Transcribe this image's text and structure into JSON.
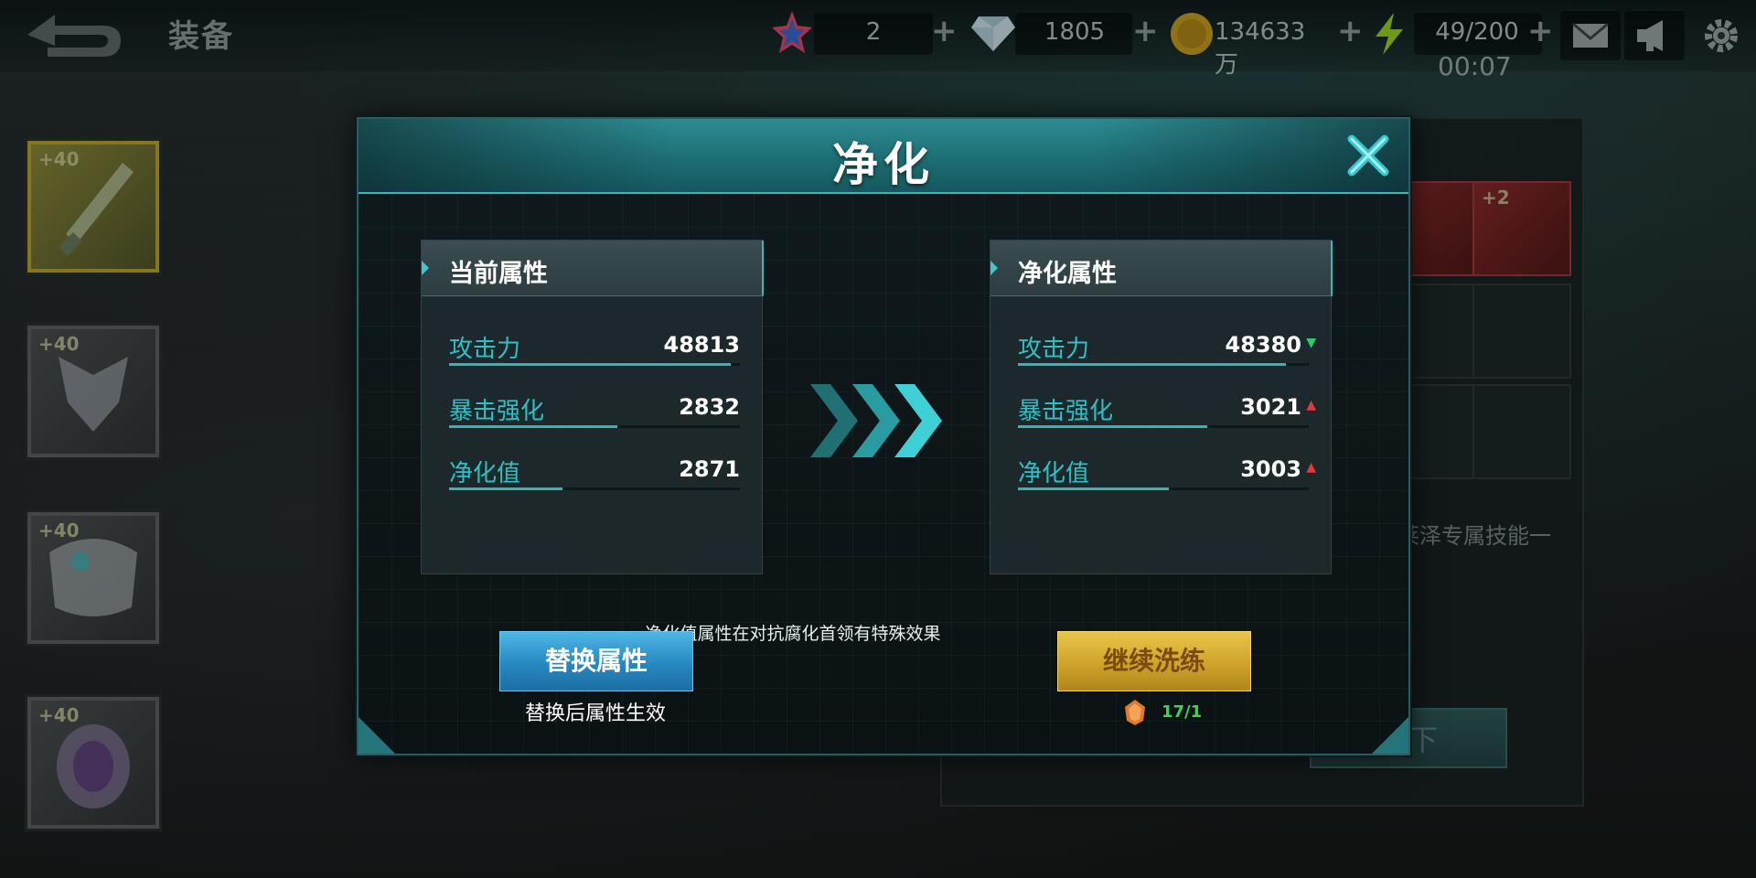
{
  "topbar": {
    "title": "装备",
    "resources": [
      {
        "name": "star-gem",
        "value": "2"
      },
      {
        "name": "diamond",
        "value": "1805"
      },
      {
        "name": "gold-coin",
        "value": "134633万"
      },
      {
        "name": "energy",
        "value": "49/200"
      }
    ],
    "timer": "00:07"
  },
  "modal": {
    "title": "净化",
    "current_panel": {
      "header": "当前属性",
      "rows": [
        {
          "name": "攻击力",
          "value": "48813",
          "fill": 0.97
        },
        {
          "name": "暴击强化",
          "value": "2832",
          "fill": 0.58
        },
        {
          "name": "净化值",
          "value": "2871",
          "fill": 0.39
        }
      ]
    },
    "purify_panel": {
      "header": "净化属性",
      "rows": [
        {
          "name": "攻击力",
          "value": "48380",
          "trend": "down",
          "fill": 0.92
        },
        {
          "name": "暴击强化",
          "value": "3021",
          "trend": "up",
          "fill": 0.65
        },
        {
          "name": "净化值",
          "value": "3003",
          "trend": "up",
          "fill": 0.52
        }
      ]
    },
    "hint": "净化值属性在对抗腐化首领有特殊效果",
    "replace_button": "替换属性",
    "replace_subtext": "替换后属性生效",
    "continue_button": "继续洗练",
    "cost_value": "17/1"
  },
  "background": {
    "slot_levels": [
      "+40",
      "+40",
      "+40",
      "+40"
    ],
    "right_slot_levels": [
      "+2"
    ],
    "right_text": "莱泽专属技能一",
    "right_button": "下"
  },
  "colors": {
    "accent_teal": "#2fc0c6",
    "header_teal": "#2d8c92",
    "gold_button": "#d0a32a",
    "blue_button": "#2688c0",
    "trend_up": "#e03a3a",
    "trend_down": "#2ecc71"
  }
}
